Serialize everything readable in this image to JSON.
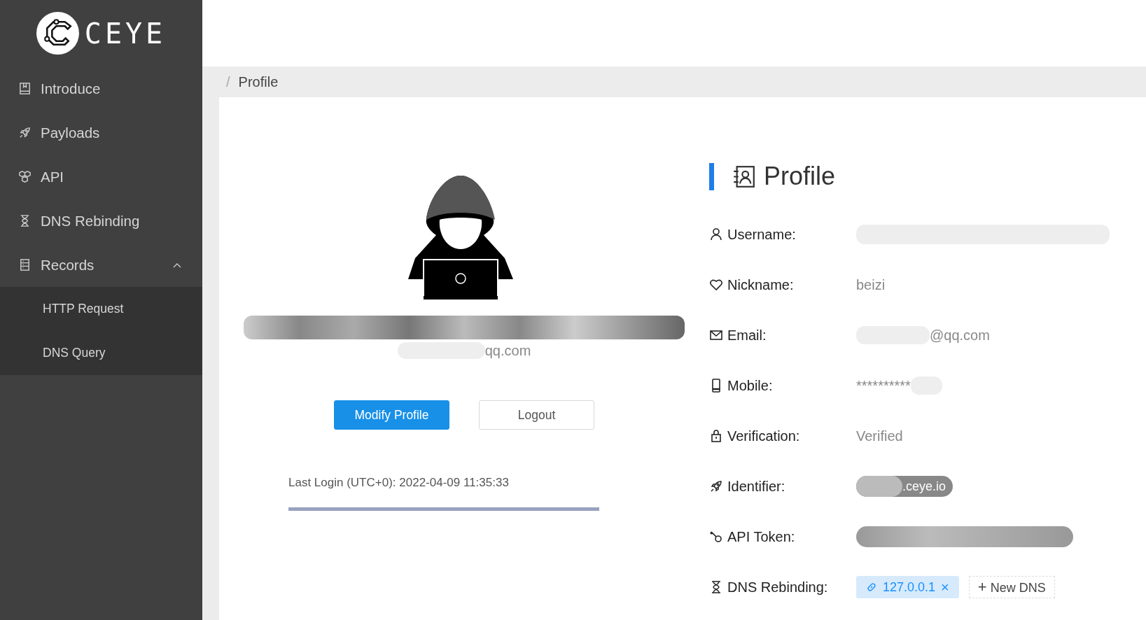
{
  "sidebar": {
    "logo": "CEYE",
    "items": [
      {
        "label": "Introduce"
      },
      {
        "label": "Payloads"
      },
      {
        "label": "API"
      },
      {
        "label": "DNS Rebinding"
      },
      {
        "label": "Records",
        "expanded": true,
        "children": [
          {
            "label": "HTTP Request"
          },
          {
            "label": "DNS Query"
          }
        ]
      }
    ]
  },
  "breadcrumb": {
    "separator": "/",
    "current": "Profile"
  },
  "user_card": {
    "email_visible": "qq.com",
    "buttons": [
      {
        "label": "Modify Profile",
        "kind": "primary"
      },
      {
        "label": "Logout",
        "kind": "default"
      }
    ],
    "last_login": "Last Login (UTC+0): 2022-04-09 11:35:33"
  },
  "profile": {
    "title": "Profile",
    "fields": [
      {
        "label": "Username:",
        "kind": "redacted"
      },
      {
        "label": "Nickname:",
        "kind": "text",
        "value": "beizi"
      },
      {
        "label": "Email:",
        "kind": "partial",
        "value": "@qq.com"
      },
      {
        "label": "Mobile:",
        "kind": "masked",
        "value": "**********"
      },
      {
        "label": "Verification:",
        "kind": "text",
        "value": "Verified"
      },
      {
        "label": "Identifier:",
        "kind": "pill",
        "value": ".ceye.io"
      },
      {
        "label": "API Token:",
        "kind": "token"
      },
      {
        "label": "DNS Rebinding:",
        "kind": "tags",
        "tags": [
          "127.0.0.1"
        ],
        "add_label": "New DNS",
        "remove": "×",
        "add": "+"
      }
    ]
  }
}
